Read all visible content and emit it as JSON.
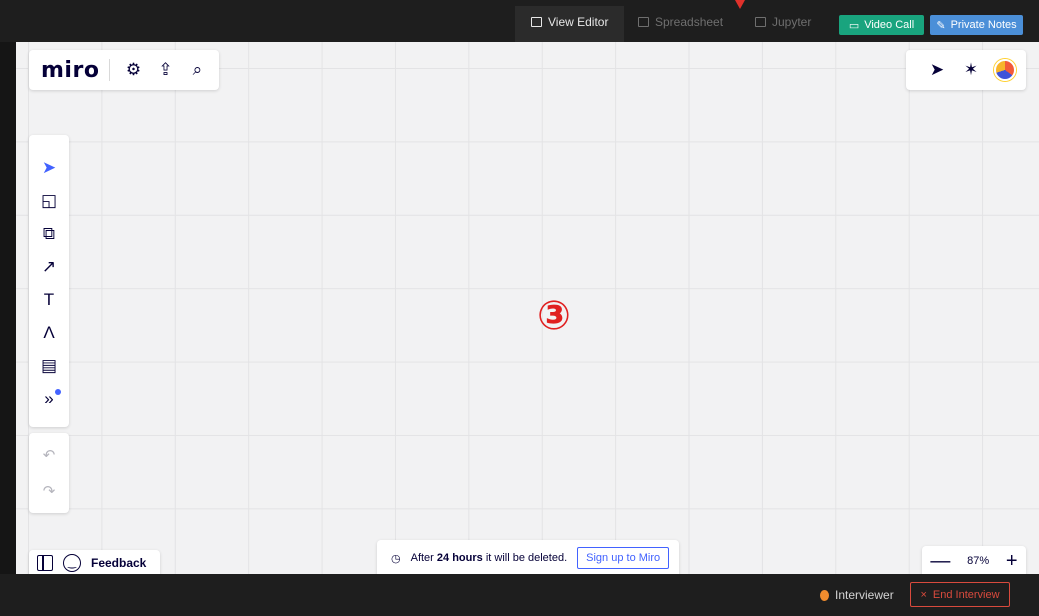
{
  "topbar": {
    "tabs": [
      {
        "label": "View Editor",
        "icon": "editor-icon"
      },
      {
        "label": "Spreadsheet",
        "icon": "spreadsheet-icon"
      },
      {
        "label": "Jupyter",
        "icon": "jupyter-icon"
      }
    ],
    "video_call": "Video Call",
    "private_notes": "Private Notes"
  },
  "board": {
    "logo": "miro",
    "center_label": "③"
  },
  "notice": {
    "prefix": "After ",
    "bold": "24 hours",
    "suffix": " it will be deleted.",
    "signup": "Sign up to Miro"
  },
  "feedback": {
    "label": "Feedback"
  },
  "zoom": {
    "value": "87%",
    "minus": "—",
    "plus": "+"
  },
  "bottombar": {
    "role": "Interviewer",
    "end": "End Interview",
    "end_icon": "×"
  },
  "colors": {
    "accent": "#4262ff",
    "video": "#19a47e",
    "notes": "#4b8fd8",
    "danger": "#d94a3d"
  }
}
